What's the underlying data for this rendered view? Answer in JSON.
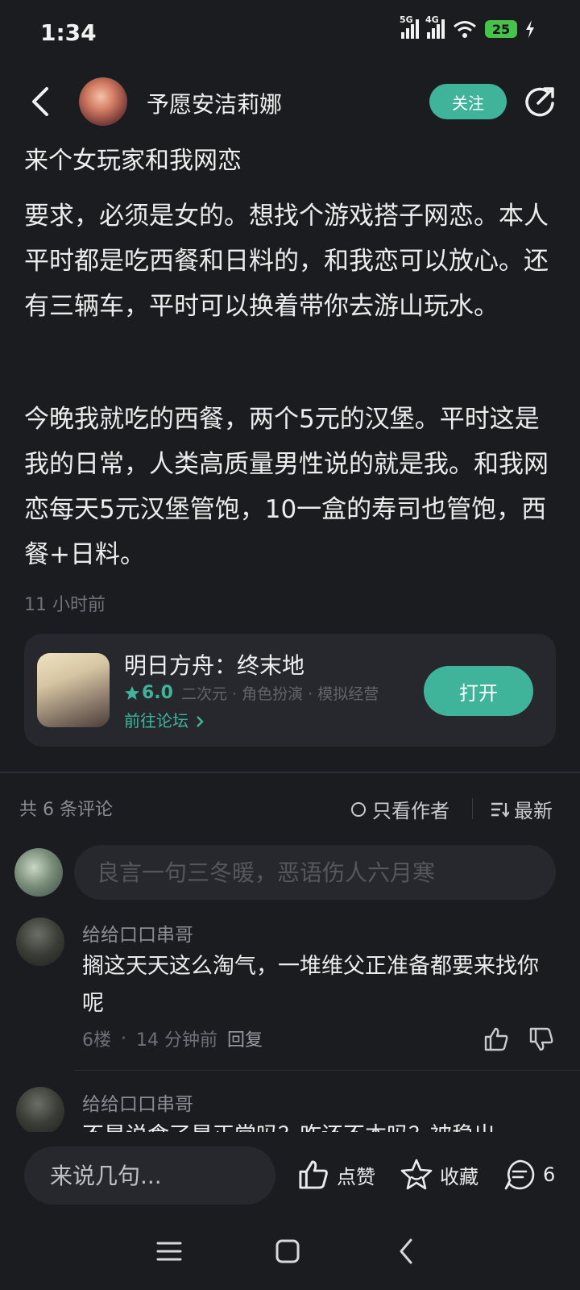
{
  "status_bar": {
    "time": "1:34",
    "network1": "5G",
    "network2": "4G",
    "battery": "25"
  },
  "header": {
    "author": "予愿安洁莉娜",
    "follow_label": "关注"
  },
  "post": {
    "title": "来个女玩家和我网恋",
    "paragraph1": "要求，必须是女的。想找个游戏搭子网恋。本人平时都是吃西餐和日料的，和我恋可以放心。还有三辆车，平时可以换着带你去游山玩水。",
    "paragraph2": "今晚我就吃的西餐，两个5元的汉堡。平时这是我的日常，人类高质量男性说的就是我。和我网恋每天5元汉堡管饱，10一盒的寿司也管饱，西餐+日料。",
    "time": "11 小时前"
  },
  "game_card": {
    "name": "明日方舟：终末地",
    "score": "6.0",
    "tags": "二次元 · 角色扮演 · 模拟经营",
    "forum_link": "前往论坛",
    "open_label": "打开"
  },
  "comments_header": {
    "count": "共 6 条评论",
    "only_author": "只看作者",
    "sort": "最新"
  },
  "comment_input": {
    "placeholder": "良言一句三冬暖，恶语伤人六月寒"
  },
  "comments": [
    {
      "user": "给给口口串哥",
      "text": "搁这天天这么淘气，一堆维父正准备都要来找你呢",
      "floor": "6楼",
      "time": "14 分钟前",
      "reply": "回复"
    },
    {
      "user": "给给口口串哥",
      "text": "不是说食了是正常吗？咋还不本吗？被稳出"
    }
  ],
  "bottom_bar": {
    "input_placeholder": "来说几句...",
    "like_label": "点赞",
    "collect_label": "收藏",
    "comment_count": "6"
  },
  "colors": {
    "accent": "#3fb49a",
    "background": "#1b1c20",
    "card": "#26282d"
  }
}
